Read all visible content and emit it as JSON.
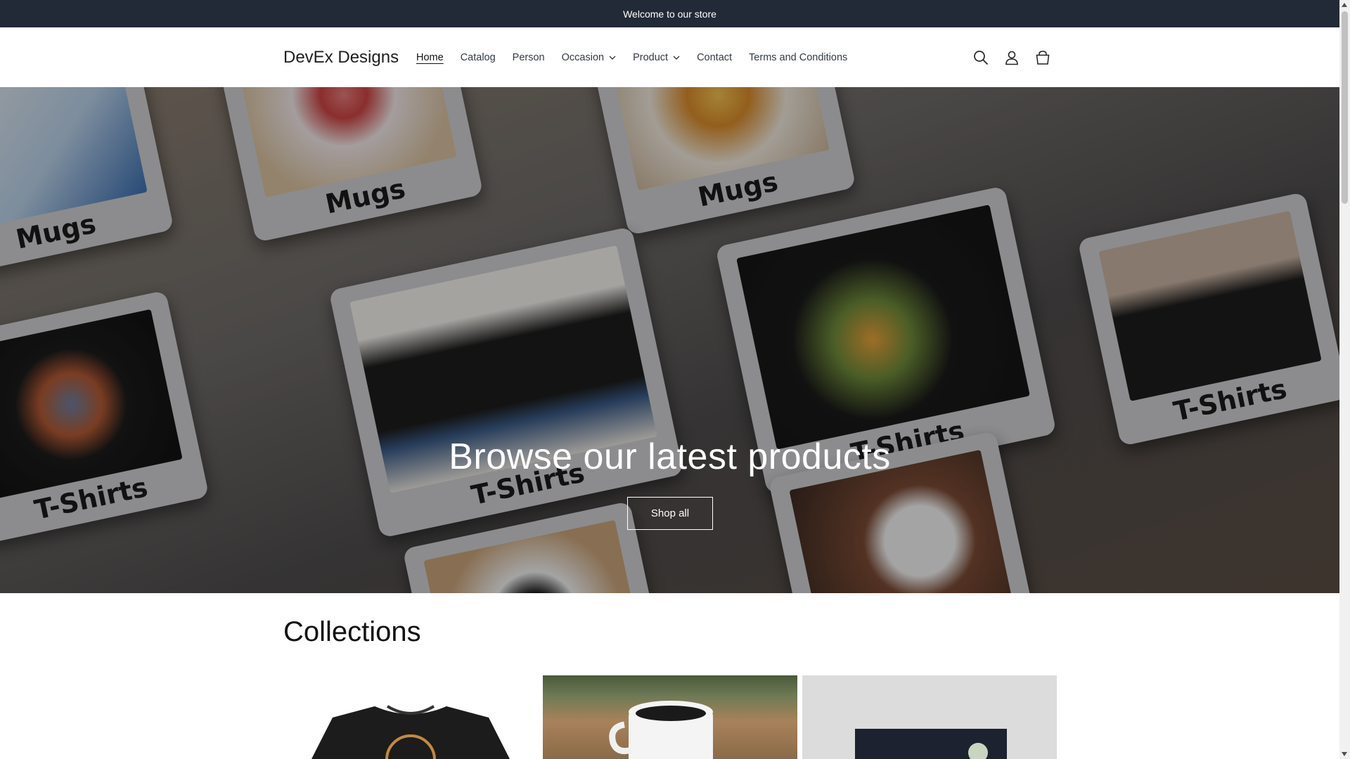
{
  "announcement": "Welcome to our store",
  "header": {
    "brand": "DevEx Designs",
    "nav": [
      {
        "label": "Home",
        "active": true,
        "dropdown": false
      },
      {
        "label": "Catalog",
        "active": false,
        "dropdown": false
      },
      {
        "label": "Person",
        "active": false,
        "dropdown": false
      },
      {
        "label": "Occasion",
        "active": false,
        "dropdown": true
      },
      {
        "label": "Product",
        "active": false,
        "dropdown": true
      },
      {
        "label": "Contact",
        "active": false,
        "dropdown": false
      },
      {
        "label": "Terms and Conditions",
        "active": false,
        "dropdown": false
      }
    ],
    "icons": [
      "search-icon",
      "account-icon",
      "cart-icon"
    ]
  },
  "hero": {
    "title": "Browse our latest products",
    "button": "Shop all",
    "card_captions": [
      "Mugs",
      "Mugs",
      "Mugs",
      "T-Shirts",
      "T-Shirts",
      "T-Shirts",
      "T-Shirts"
    ]
  },
  "collections": {
    "title": "Collections"
  },
  "colors": {
    "announcement_bg": "#232a37",
    "text": "#121212",
    "background": "#ffffff"
  }
}
